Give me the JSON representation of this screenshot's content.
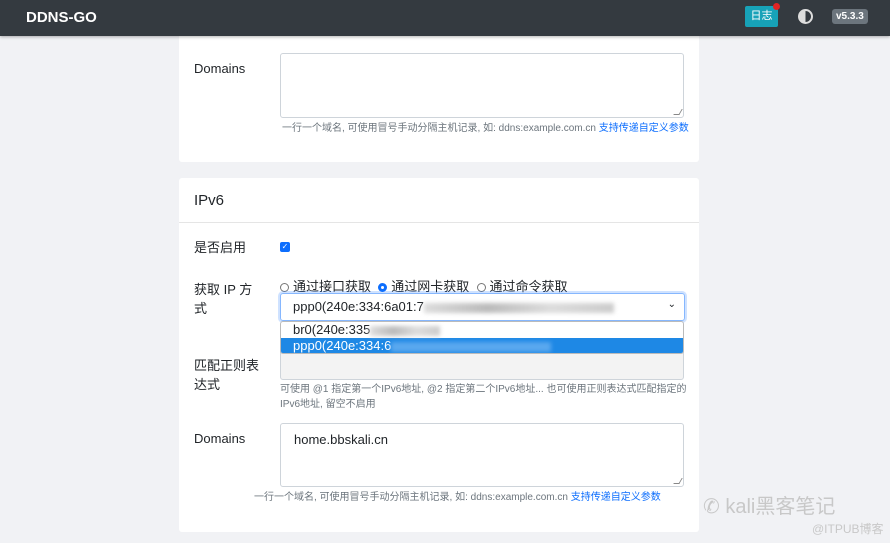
{
  "navbar": {
    "brand": "DDNS-GO",
    "log_label": "日志",
    "version": "v5.3.3"
  },
  "ipv4_card": {
    "domains_label": "Domains",
    "domains_value": "",
    "domains_help": "一行一个域名, 可使用冒号手动分隔主机记录, 如: ddns:example.com.cn",
    "domains_help_link": "支持传递自定义参数"
  },
  "ipv6_card": {
    "title": "IPv6",
    "enable_label": "是否启用",
    "enabled": true,
    "get_ip_label": "获取 IP 方式",
    "get_ip_options": [
      "通过接口获取",
      "通过网卡获取",
      "通过命令获取"
    ],
    "get_ip_selected": 1,
    "interface_selected": "ppp0(240e:334:6a01:7",
    "interface_options": [
      "br0(240e:335",
      "ppp0(240e:334:6"
    ],
    "regex_label": "匹配正则表达式",
    "regex_help": "可使用 @1 指定第一个IPv6地址, @2 指定第二个IPv6地址... 也可使用正则表达式匹配指定的IPv6地址, 留空不启用",
    "domains_label": "Domains",
    "domains_value": "home.bbskali.cn",
    "domains_help": "一行一个域名, 可使用冒号手动分隔主机记录, 如: ddns:example.com.cn",
    "domains_help_link": "支持传递自定义参数"
  },
  "watermark": {
    "line1": "kali黑客笔记",
    "line2": "@ITPUB博客"
  },
  "colors": {
    "navbar": "#343a40",
    "accent": "#0d6efd",
    "log_button": "#17a2b8"
  }
}
